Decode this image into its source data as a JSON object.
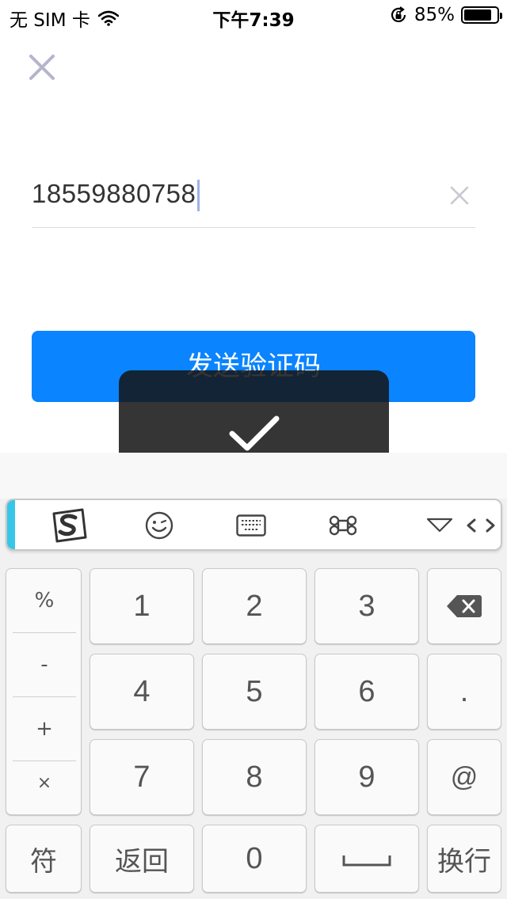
{
  "status_bar": {
    "carrier": "无 SIM 卡",
    "time": "下午7:39",
    "battery": "85%",
    "battery_level": 0.85
  },
  "form": {
    "phone_value": "18559880758",
    "send_button": "发送验证码"
  },
  "keyboard": {
    "symbols": [
      "%",
      "-",
      "+",
      "×"
    ],
    "keys_row1": [
      "1",
      "2",
      "3"
    ],
    "keys_row2": [
      "4",
      "5",
      "6",
      "."
    ],
    "keys_row3": [
      "7",
      "8",
      "9",
      "@"
    ],
    "bottom": {
      "symbol": "符",
      "back": "返回",
      "zero": "0",
      "enter": "换行"
    },
    "toolbar_icons": [
      "sogou-logo-icon",
      "emoji-icon",
      "keyboard-icon",
      "command-icon",
      "hide-keyboard-icon",
      "cursor-move-icon"
    ]
  },
  "colors": {
    "accent": "#0a84ff",
    "toolbar_accent": "#38c6e8"
  }
}
